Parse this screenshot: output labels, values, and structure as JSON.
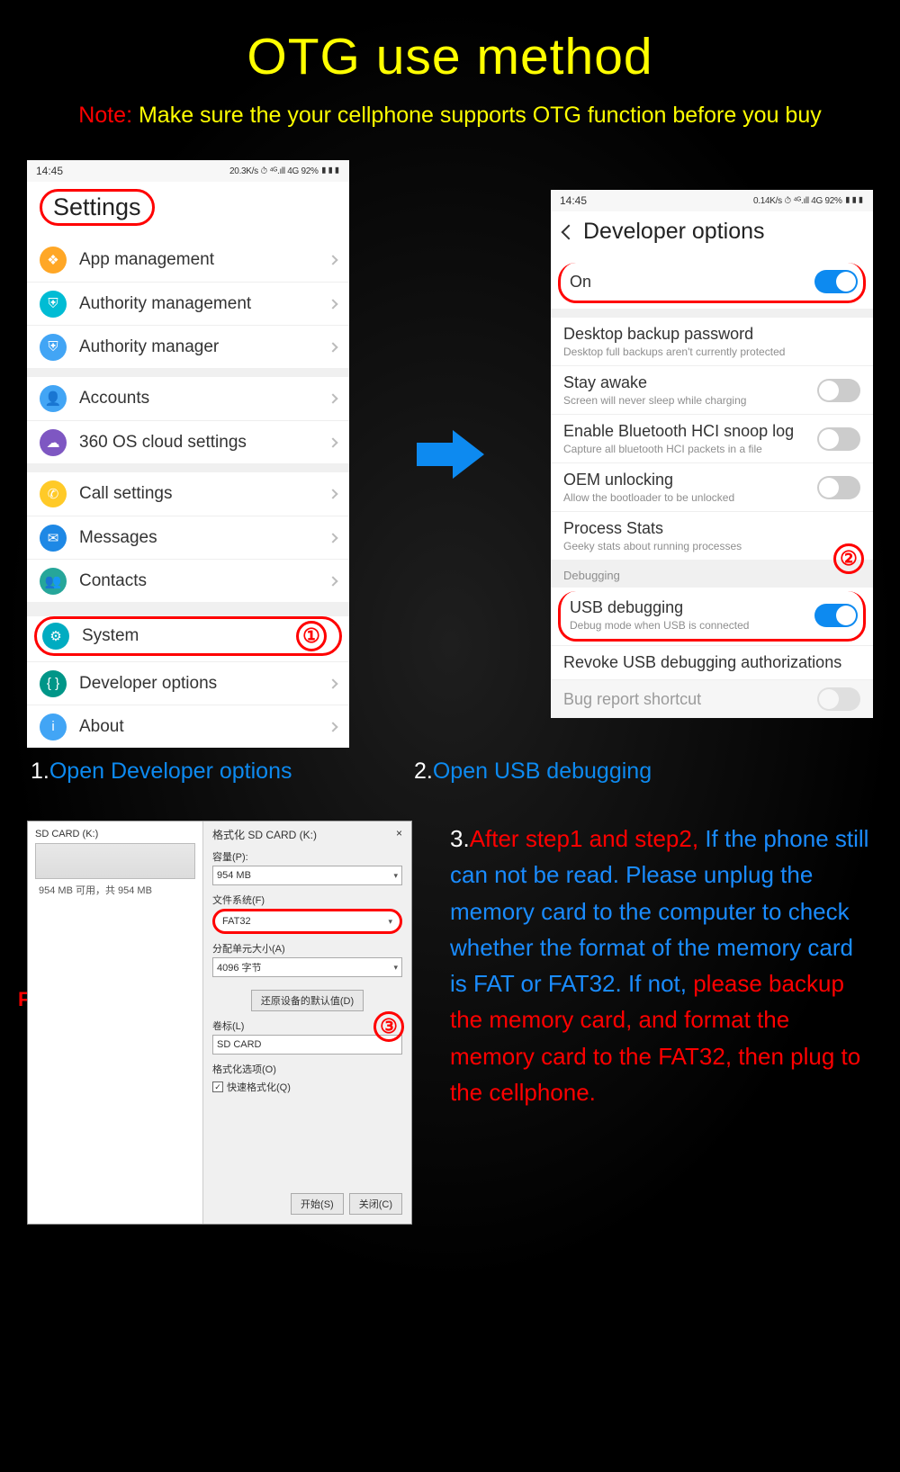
{
  "header": {
    "title": "OTG use method",
    "note_label": "Note:",
    "note_text": " Make sure the your cellphone supports OTG function before you buy"
  },
  "phone1": {
    "time": "14:45",
    "status_right": "20.3K/s ⏱ ⁴ᴳ.ıll 4G 92% ▮▮▮",
    "title": "Settings",
    "groups": [
      {
        "items": [
          {
            "icon": "ic-orange",
            "glyph": "❖",
            "label": "App management"
          },
          {
            "icon": "ic-teal",
            "glyph": "⛨",
            "label": "Authority management"
          },
          {
            "icon": "ic-blue",
            "glyph": "⛨",
            "label": "Authority manager"
          }
        ]
      },
      {
        "items": [
          {
            "icon": "ic-blue",
            "glyph": "👤",
            "label": "Accounts"
          },
          {
            "icon": "ic-purple",
            "glyph": "☁",
            "label": "360 OS cloud settings"
          }
        ]
      },
      {
        "items": [
          {
            "icon": "ic-yellow",
            "glyph": "✆",
            "label": "Call settings"
          },
          {
            "icon": "ic-dblue",
            "glyph": "✉",
            "label": "Messages"
          },
          {
            "icon": "ic-green",
            "glyph": "👥",
            "label": "Contacts"
          }
        ]
      },
      {
        "items": [
          {
            "icon": "ic-cyan",
            "glyph": "⚙",
            "label": "System",
            "highlight": true,
            "badge": "①"
          },
          {
            "icon": "ic-dgreen",
            "glyph": "{ }",
            "label": "Developer options"
          },
          {
            "icon": "ic-blue",
            "glyph": "i",
            "label": "About"
          }
        ]
      }
    ]
  },
  "phone2": {
    "time": "14:45",
    "status_right": "0.14K/s ⏱ ⁴ᴳ.ıll 4G 92% ▮▮▮",
    "title": "Developer options",
    "on_label": "On",
    "items": [
      {
        "title": "Desktop backup password",
        "sub": "Desktop full backups aren't currently protected"
      },
      {
        "title": "Stay awake",
        "sub": "Screen will never sleep while charging",
        "toggle": false
      },
      {
        "title": "Enable Bluetooth HCI snoop log",
        "sub": "Capture all bluetooth HCI packets in a file",
        "toggle": false
      },
      {
        "title": "OEM unlocking",
        "sub": "Allow the bootloader to be unlocked",
        "toggle": false
      },
      {
        "title": "Process Stats",
        "sub": "Geeky stats about running processes"
      }
    ],
    "section_label": "Debugging",
    "badge2": "②",
    "usb": {
      "title": "USB debugging",
      "sub": "Debug mode when USB is connected"
    },
    "revoke": "Revoke USB debugging authorizations",
    "bug": "Bug report shortcut"
  },
  "captions": {
    "c1_num": "1.",
    "c1_text": "Open Developer options",
    "c2_num": "2.",
    "c2_text": "Open USB debugging"
  },
  "fat_label": "FAT or FAT32",
  "win": {
    "left_title": "SD CARD (K:)",
    "left_sub": "954 MB 可用，共 954 MB",
    "title": "格式化 SD CARD (K:)",
    "close": "×",
    "cap_label": "容量(P):",
    "cap_val": "954 MB",
    "fs_label": "文件系统(F)",
    "fs_val": "FAT32",
    "au_label": "分配单元大小(A)",
    "au_val": "4096 字节",
    "restore_btn": "还原设备的默认值(D)",
    "vol_label": "卷标(L)",
    "vol_val": "SD CARD",
    "fmt_opt_label": "格式化选项(O)",
    "quick_fmt": "快速格式化(Q)",
    "badge3": "③",
    "start_btn": "开始(S)",
    "close_btn": "关闭(C)"
  },
  "step3": {
    "num": "3.",
    "red1": "After step1 and step2,",
    "blue1": "If the phone still can not be read. Please unplug the memory card to the computer to check whether the format of the memory card is FAT or FAT32. If not, ",
    "red2": "please backup the memory card, and format the memory card to the FAT32, then plug to the cellphone."
  }
}
